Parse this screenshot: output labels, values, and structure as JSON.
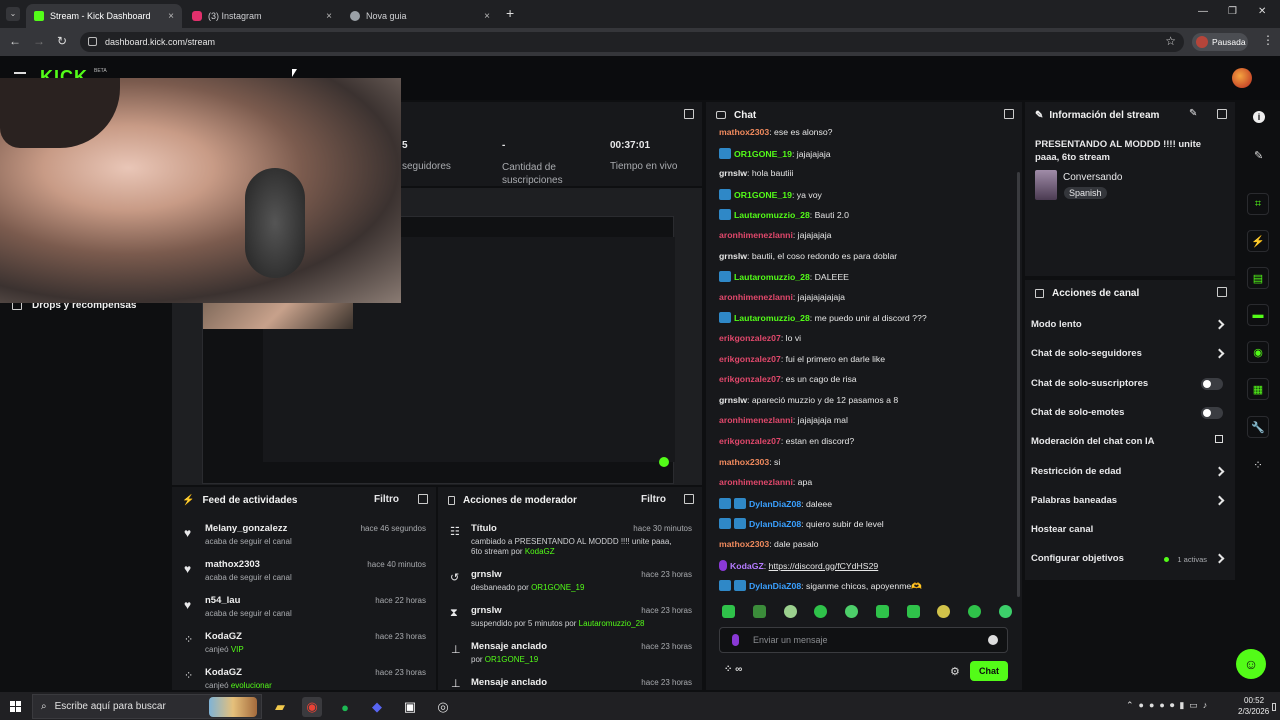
{
  "browser": {
    "tabs": [
      {
        "label": "Stream - Kick Dashboard",
        "close": "×",
        "color": "#53fc18"
      },
      {
        "label": "(3) Instagram",
        "close": "×",
        "color": "#e1306c"
      },
      {
        "label": "Nova guia",
        "close": "×",
        "color": "#9aa0a6"
      }
    ],
    "new_tab": "+",
    "url": "dashboard.kick.com/stream",
    "profile_label": "Pausada",
    "window_controls": [
      "—",
      "❐",
      "✕"
    ]
  },
  "kick": {
    "logo": "KICK",
    "beta": "BETA",
    "accent": "#53fc18"
  },
  "stats": [
    {
      "value": "5",
      "label": "seguidores"
    },
    {
      "value": "-",
      "label": "Cantidad de suscripciones"
    },
    {
      "value": "00:37:01",
      "label": "Tiempo en vivo"
    }
  ],
  "sidebar": {
    "drops_label": "Drops y recompensas"
  },
  "activity": {
    "title": "Feed de actividades",
    "filter": "Filtro",
    "items": [
      {
        "user": "Melany_gonzalezz",
        "action": "acaba de seguir el canal",
        "time": "hace 46 segundos",
        "icon": "heart"
      },
      {
        "user": "mathox2303",
        "action": "acaba de seguir el canal",
        "time": "hace 40 minutos",
        "icon": "heart"
      },
      {
        "user": "n54_lau",
        "action": "acaba de seguir el canal",
        "time": "hace 22 horas",
        "icon": "heart"
      },
      {
        "user": "KodaGZ",
        "action": "canjeó",
        "reward": "VIP",
        "time": "hace 23 horas",
        "icon": "points"
      },
      {
        "user": "KodaGZ",
        "action": "canjeó",
        "reward": "evolucionar",
        "time": "hace 23 horas",
        "icon": "points"
      }
    ]
  },
  "modactions": {
    "title": "Acciones de moderador",
    "filter": "Filtro",
    "items": [
      {
        "title": "Título",
        "line1": "cambiado a PRESENTANDO AL MODDD !!!! unite paaa,",
        "line2": "6to stream",
        "by": "por",
        "actor": "KodaGZ",
        "time": "hace 30 minutos"
      },
      {
        "title": "grnslw",
        "line1": "desbaneado por",
        "line2": "",
        "by": "",
        "actor": "OR1GONE_19",
        "time": "hace 23 horas"
      },
      {
        "title": "grnslw",
        "line1": "suspendido por 5 minutos por",
        "line2": "",
        "by": "",
        "actor": "Lautaromuzzio_28",
        "time": "hace 23 horas"
      },
      {
        "title": "Mensaje anclado",
        "line1": "por",
        "line2": "",
        "by": "",
        "actor": "OR1GONE_19",
        "time": "hace 23 horas"
      },
      {
        "title": "Mensaje anclado",
        "line1": "",
        "line2": "",
        "by": "",
        "actor": "",
        "time": "hace 23 horas"
      }
    ]
  },
  "chat": {
    "title": "Chat",
    "messages": [
      {
        "badge": "",
        "user": "mathox2303",
        "color": "#f08a5d",
        "text": ": ese es alonso?"
      },
      {
        "badge": "blue",
        "user": "OR1GONE_19",
        "color": "#53fc18",
        "text": ": jajajajaja"
      },
      {
        "badge": "",
        "user": "grnslw",
        "color": "#e6e6e6",
        "text": ": hola bautiii"
      },
      {
        "badge": "blue",
        "user": "OR1GONE_19",
        "color": "#53fc18",
        "text": ": ya voy"
      },
      {
        "badge": "blue",
        "user": "Lautaromuzzio_28",
        "color": "#53fc18",
        "text": ": Bauti 2.0"
      },
      {
        "badge": "",
        "user": "aronhimenezlanni",
        "color": "#e0486b",
        "text": ": jajajajaja"
      },
      {
        "badge": "",
        "user": "grnslw",
        "color": "#e6e6e6",
        "text": ": bautii, el coso redondo es para doblar"
      },
      {
        "badge": "blue",
        "user": "Lautaromuzzio_28",
        "color": "#53fc18",
        "text": ": DALEEE"
      },
      {
        "badge": "",
        "user": "aronhimenezlanni",
        "color": "#e0486b",
        "text": ": jajajajajajaja"
      },
      {
        "badge": "blue",
        "user": "Lautaromuzzio_28",
        "color": "#53fc18",
        "text": ": me puedo unir al discord ???"
      },
      {
        "badge": "",
        "user": "erikgonzalez07",
        "color": "#e0486b",
        "text": ": lo vi"
      },
      {
        "badge": "",
        "user": "erikgonzalez07",
        "color": "#e0486b",
        "text": ": fui el primero en darle like"
      },
      {
        "badge": "",
        "user": "erikgonzalez07",
        "color": "#e0486b",
        "text": ": es un cago de risa"
      },
      {
        "badge": "",
        "user": "grnslw",
        "color": "#e6e6e6",
        "text": ": apareció muzzio y de 12 pasamos a 8"
      },
      {
        "badge": "",
        "user": "aronhimenezlanni",
        "color": "#e0486b",
        "text": ": jajajajaja mal"
      },
      {
        "badge": "",
        "user": "erikgonzalez07",
        "color": "#e0486b",
        "text": ": estan en discord?"
      },
      {
        "badge": "",
        "user": "mathox2303",
        "color": "#f08a5d",
        "text": ": si"
      },
      {
        "badge": "",
        "user": "aronhimenezlanni",
        "color": "#e0486b",
        "text": ": apa"
      },
      {
        "badge": "blue2",
        "user": "DylanDiaZ08",
        "color": "#3aa0ff",
        "text": ": daleee"
      },
      {
        "badge": "blue2",
        "user": "DylanDiaZ08",
        "color": "#3aa0ff",
        "text": ": quiero subir de level"
      },
      {
        "badge": "",
        "user": "mathox2303",
        "color": "#f08a5d",
        "text": ": dale pasalo"
      },
      {
        "badge": "purple",
        "user": "KodaGZ",
        "color": "#b57bff",
        "text": ": ",
        "link": "https://discord.gg/fCYdHS29"
      },
      {
        "badge": "blue2",
        "user": "DylanDiaZ08",
        "color": "#3aa0ff",
        "text": ": siganme chicos, apoyenme🫶"
      }
    ],
    "input_placeholder": "Enviar un mensaje",
    "infinity": "∞",
    "send_label": "Chat"
  },
  "stream_info": {
    "title": "Información del stream",
    "stream_title": "PRESENTANDO AL MODDD !!!! unite paaa, 6to stream",
    "category": "Conversando",
    "language": "Spanish"
  },
  "channel_actions": {
    "title": "Acciones de canal",
    "items": [
      {
        "label": "Modo lento",
        "control": "chevron"
      },
      {
        "label": "Chat de solo-seguidores",
        "control": "chevron"
      },
      {
        "label": "Chat de solo-suscriptores",
        "control": "toggle"
      },
      {
        "label": "Chat de solo-emotes",
        "control": "toggle"
      },
      {
        "label": "Moderación del chat con IA",
        "control": "external"
      },
      {
        "label": "Restricción de edad",
        "control": "chevron"
      },
      {
        "label": "Palabras baneadas",
        "control": "chevron"
      },
      {
        "label": "Hostear canal",
        "control": "none"
      },
      {
        "label": "Configurar objetivos",
        "control": "chevron",
        "extra": "1 activas"
      }
    ]
  },
  "taskbar": {
    "search_placeholder": "Escribe aquí para buscar",
    "time": "00:52",
    "date": "2/3/2026"
  }
}
